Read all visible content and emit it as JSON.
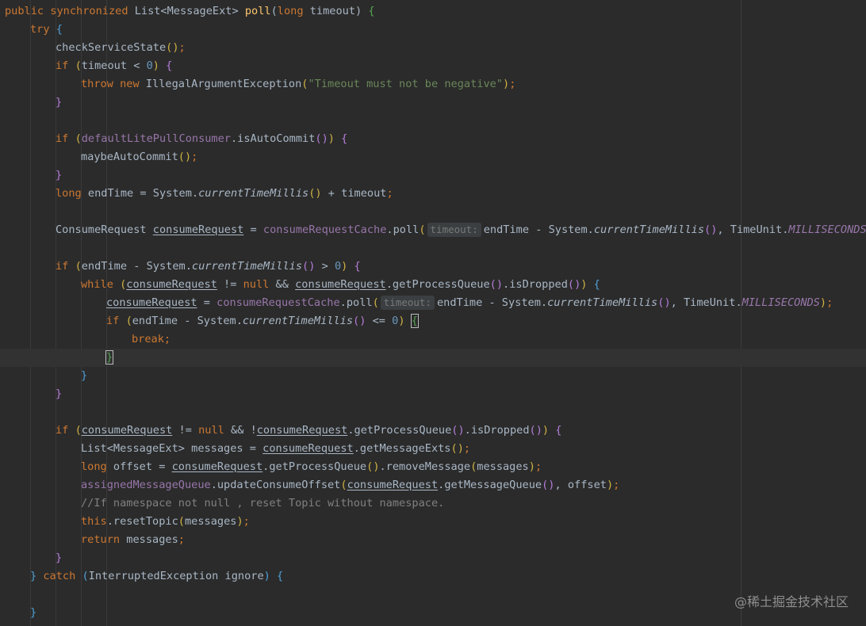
{
  "editor": {
    "language": "Java",
    "watermark": "@稀土掘金技术社区"
  },
  "code": {
    "l01": [
      "public",
      " ",
      "synchronized",
      " List<MessageExt> ",
      "poll",
      "(",
      "long",
      " timeout) ",
      "{"
    ],
    "l02": [
      "try",
      " ",
      "{"
    ],
    "l03": [
      "checkServiceState",
      "(",
      ")",
      ";"
    ],
    "l04": [
      "if",
      " ",
      "(",
      "timeout < ",
      "0",
      ")",
      " ",
      "{"
    ],
    "l05": [
      "throw",
      " ",
      "new",
      " IllegalArgumentException",
      "(",
      "\"Timeout must not be negative\"",
      ")",
      ";"
    ],
    "l06": [
      "}"
    ],
    "l07": [
      "if",
      " ",
      "(",
      "defaultLitePullConsumer",
      ".isAutoCommit",
      "(",
      ")",
      ")",
      " ",
      "{"
    ],
    "l08": [
      "maybeAutoCommit",
      "(",
      ")",
      ";"
    ],
    "l09": [
      "}"
    ],
    "l10": [
      "long",
      " endTime = System.",
      "currentTimeMillis",
      "(",
      ")",
      " + timeout",
      ";"
    ],
    "l11": [
      "ConsumeRequest ",
      "consumeRequest",
      " = ",
      "consumeRequestCache",
      ".poll",
      "(",
      "timeout:",
      "endTime - System.",
      "currentTimeMillis",
      "(",
      ")",
      ", TimeUnit.",
      "MILLISECONDS",
      ")",
      ";"
    ],
    "l12": [
      "if",
      " ",
      "(",
      "endTime - System.",
      "currentTimeMillis",
      "(",
      ")",
      " > ",
      "0",
      ")",
      " ",
      "{"
    ],
    "l13": [
      "while",
      " ",
      "(",
      "consumeRequest",
      " != ",
      "null",
      " && ",
      "consumeRequest",
      ".getProcessQueue",
      "(",
      ")",
      ".isDropped",
      "(",
      ")",
      ")",
      " ",
      "{"
    ],
    "l14": [
      "consumeRequest",
      " = ",
      "consumeRequestCache",
      ".poll",
      "(",
      "timeout:",
      "endTime - System.",
      "currentTimeMillis",
      "(",
      ")",
      ", TimeUnit.",
      "MILLISECONDS",
      ")",
      ";"
    ],
    "l15": [
      "if",
      " ",
      "(",
      "endTime - System.",
      "currentTimeMillis",
      "(",
      ")",
      " <= ",
      "0",
      ")",
      " ",
      "{"
    ],
    "l16": [
      "break",
      ";"
    ],
    "l17": [
      "}"
    ],
    "l18": [
      "}"
    ],
    "l19": [
      "}"
    ],
    "l20": [
      "if",
      " ",
      "(",
      "consumeRequest",
      " != ",
      "null",
      " && !",
      "consumeRequest",
      ".getProcessQueue",
      "(",
      ")",
      ".isDropped",
      "(",
      ")",
      ")",
      " ",
      "{"
    ],
    "l21": [
      "List<MessageExt> messages = ",
      "consumeRequest",
      ".getMessageExts",
      "(",
      ")",
      ";"
    ],
    "l22": [
      "long",
      " offset = ",
      "consumeRequest",
      ".getProcessQueue",
      "(",
      ")",
      ".removeMessage",
      "(",
      "messages",
      ")",
      ";"
    ],
    "l23": [
      "assignedMessageQueue",
      ".updateConsumeOffset",
      "(",
      "consumeRequest",
      ".getMessageQueue",
      "(",
      ")",
      ", offset",
      ")",
      ";"
    ],
    "l24": [
      "//If namespace not null , reset Topic without namespace."
    ],
    "l25": [
      "this",
      ".resetTopic",
      "(",
      "messages",
      ")",
      ";"
    ],
    "l26": [
      "return",
      " messages",
      ";"
    ],
    "l27": [
      "}"
    ],
    "l28": [
      "}",
      " ",
      "catch",
      " ",
      "(",
      "InterruptedException ignore",
      ")",
      " ",
      "{"
    ],
    "l29": [
      "}"
    ]
  }
}
